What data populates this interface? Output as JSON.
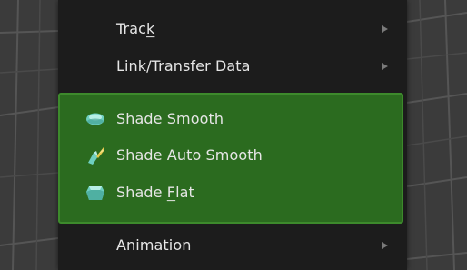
{
  "menu": {
    "items": [
      {
        "pre": "Trac",
        "ul": "k",
        "post": "",
        "has_submenu": true
      },
      {
        "pre": "Link/Transfer Data",
        "ul": "",
        "post": "",
        "has_submenu": true
      },
      {
        "pre": "Shade Smooth",
        "ul": "",
        "post": "",
        "icon": "shade-smooth-icon"
      },
      {
        "pre": "Shade Auto Smooth",
        "ul": "",
        "post": "",
        "icon": "shade-auto-smooth-icon"
      },
      {
        "pre": "Shade ",
        "ul": "F",
        "post": "lat",
        "icon": "shade-flat-icon"
      },
      {
        "pre": "Animation",
        "ul": "",
        "post": "",
        "has_submenu": true
      }
    ]
  },
  "colors": {
    "menu_bg": "#1c1c1c",
    "highlight_bg": "#2b6b1f",
    "highlight_border": "#3d8a2c",
    "text": "#e6e6e6",
    "icon_teal": "#7fd6c8"
  }
}
